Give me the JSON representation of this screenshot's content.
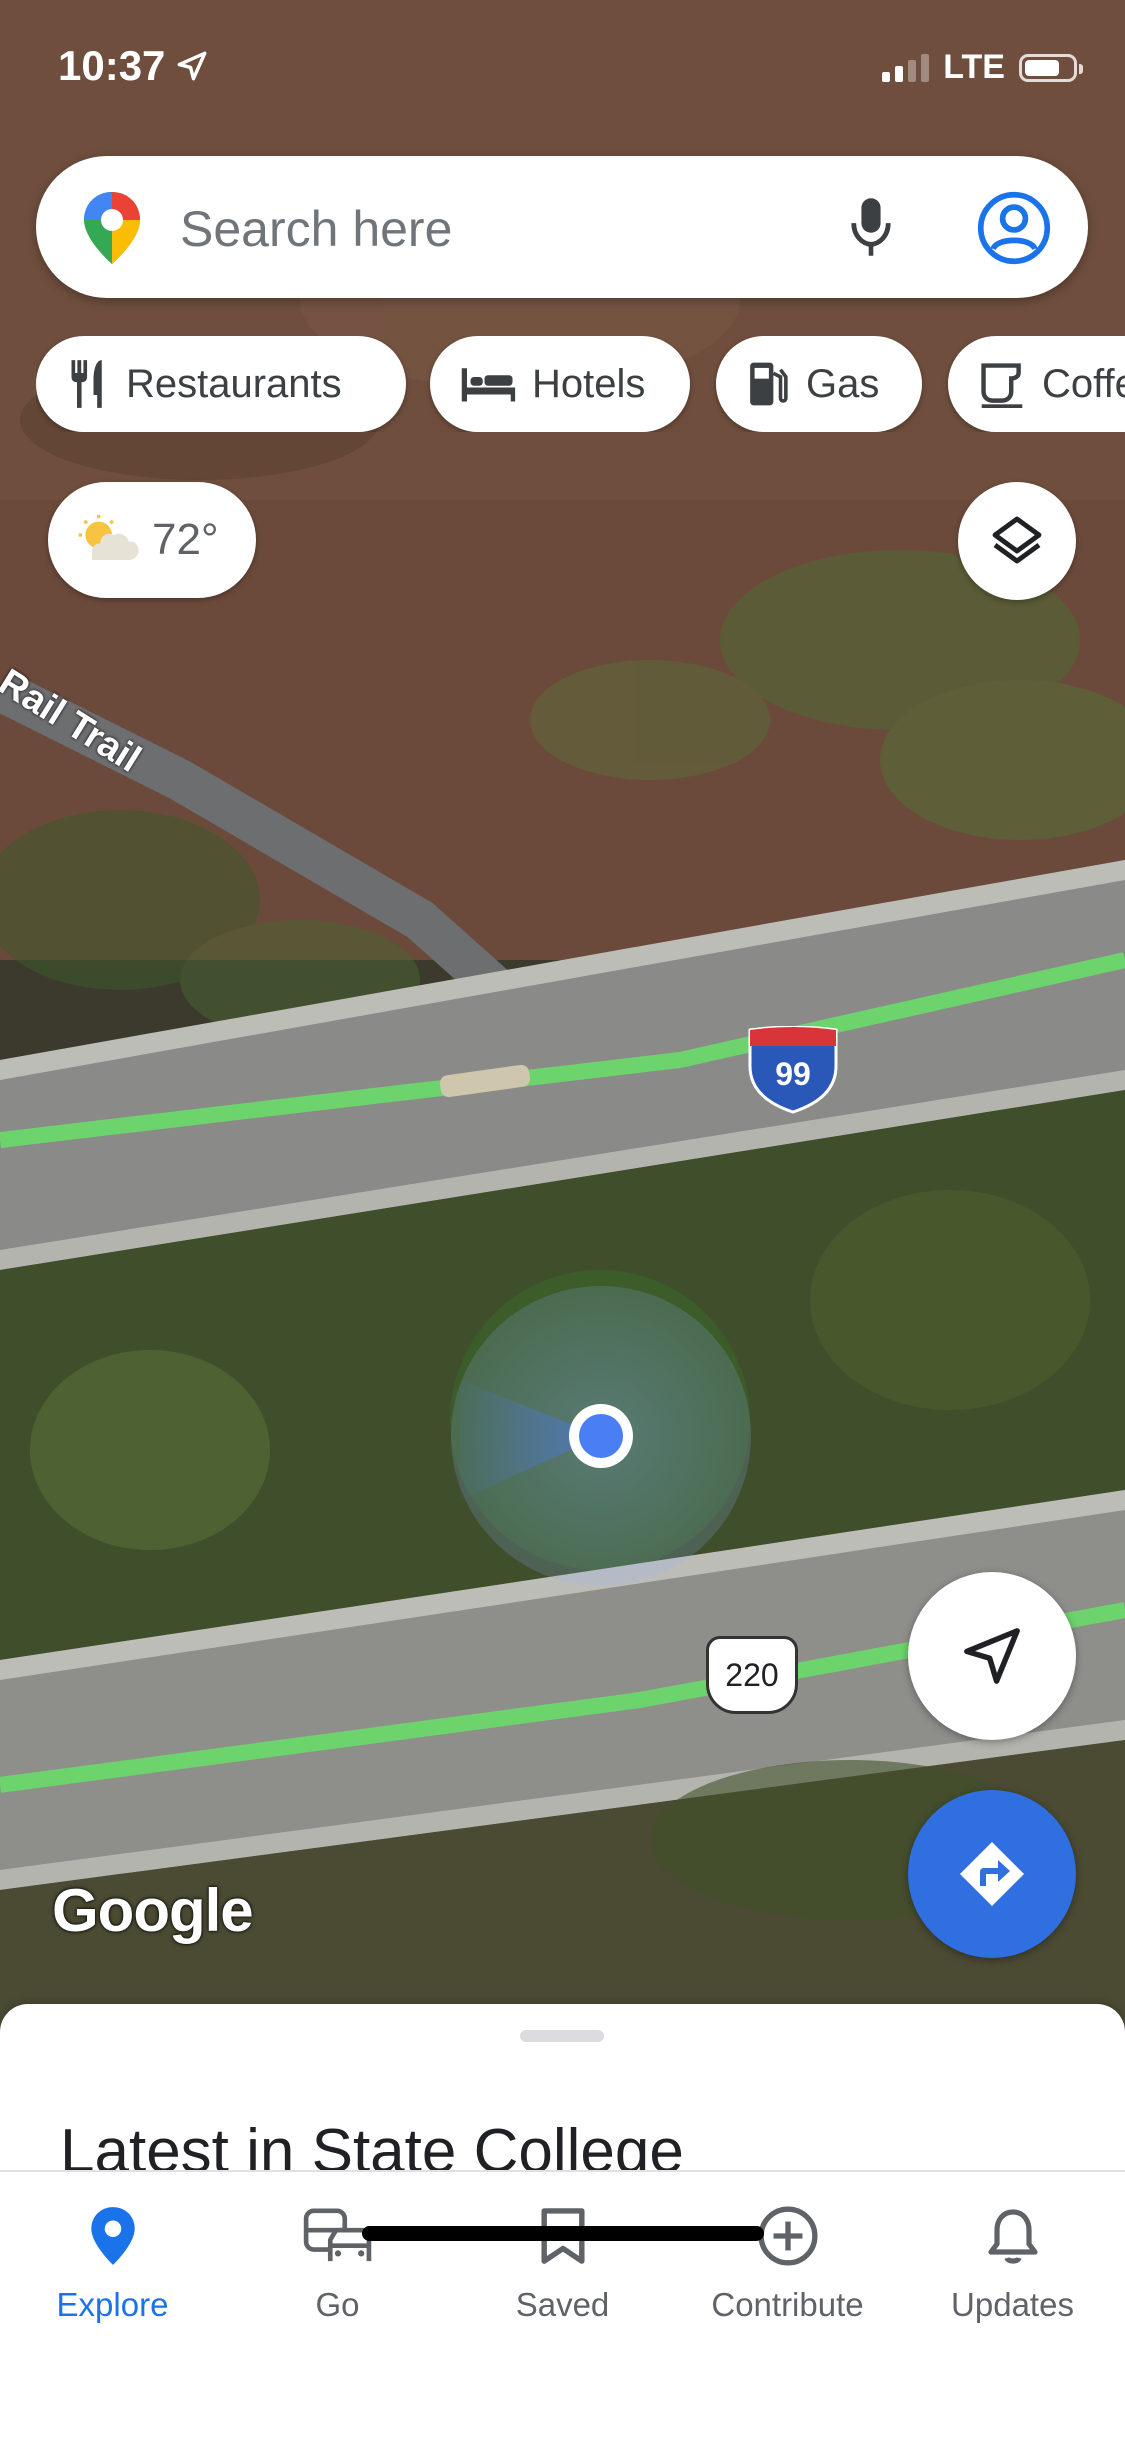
{
  "status_bar": {
    "time": "10:37",
    "network": "LTE",
    "location_icon": "location-arrow-icon"
  },
  "search": {
    "placeholder": "Search here",
    "logo_icon": "maps-pin-logo-icon",
    "mic_icon": "mic-icon",
    "account_icon": "account-circle-icon"
  },
  "chips": [
    {
      "label": "Restaurants",
      "icon": "fork-knife-icon"
    },
    {
      "label": "Hotels",
      "icon": "bed-icon"
    },
    {
      "label": "Gas",
      "icon": "gas-pump-icon"
    },
    {
      "label": "Coffee",
      "icon": "coffee-cup-icon"
    }
  ],
  "weather": {
    "temperature": "72°",
    "icon": "partly-cloudy-icon"
  },
  "map": {
    "trail_label": "Rail Trail",
    "interstate_shield": "99",
    "us_route_shield": "220",
    "watermark": "Google",
    "traffic_color": "#6dd36d"
  },
  "controls": {
    "layers_icon": "layers-icon",
    "locate_icon": "navigation-arrow-icon",
    "directions_icon": "directions-icon"
  },
  "bottom_sheet": {
    "title": "Latest in State College"
  },
  "nav": [
    {
      "label": "Explore",
      "icon": "explore-pin-icon",
      "active": true
    },
    {
      "label": "Go",
      "icon": "commute-icon",
      "active": false
    },
    {
      "label": "Saved",
      "icon": "bookmark-icon",
      "active": false
    },
    {
      "label": "Contribute",
      "icon": "add-circle-icon",
      "active": false
    },
    {
      "label": "Updates",
      "icon": "bell-icon",
      "active": false
    }
  ],
  "colors": {
    "accent": "#1a73e8",
    "directions_fab": "#2f6fe0"
  }
}
